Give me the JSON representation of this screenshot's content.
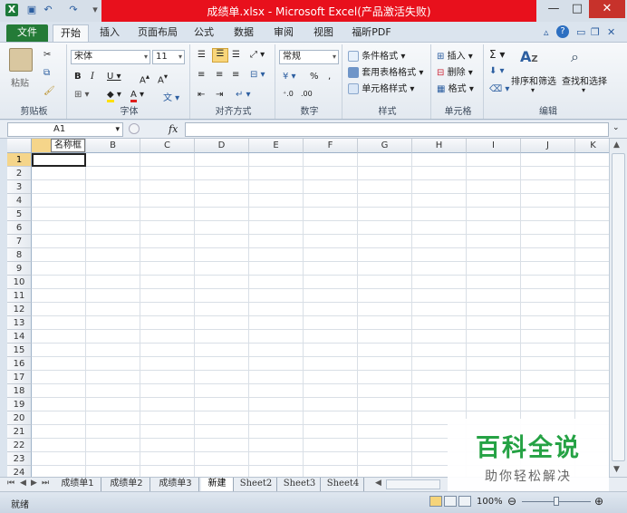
{
  "window": {
    "title": "成绩单.xlsx - Microsoft Excel(产品激活失败)",
    "title_bar_color": "#e8101c",
    "controls": [
      "—",
      "□",
      "✕"
    ]
  },
  "ribbon_tabs": [
    "文件",
    "开始",
    "插入",
    "页面布局",
    "公式",
    "数据",
    "审阅",
    "视图",
    "福昕PDF"
  ],
  "active_tab": "开始",
  "accent_color": "#247b37",
  "groups": {
    "clipboard": {
      "label": "剪贴板",
      "paste": "粘贴"
    },
    "font": {
      "label": "字体",
      "font_name": "宋体",
      "font_size": "11"
    },
    "alignment": {
      "label": "对齐方式"
    },
    "number": {
      "label": "数字",
      "format": "常规"
    },
    "styles": {
      "label": "样式",
      "items": [
        "条件格式",
        "套用表格格式",
        "单元格样式"
      ]
    },
    "cells": {
      "label": "单元格",
      "items": [
        "插入",
        "删除",
        "格式"
      ]
    },
    "editing": {
      "label": "编辑",
      "sort_filter": "排序和筛选",
      "find_select": "查找和选择"
    }
  },
  "formula_bar": {
    "name_box": "A1",
    "fx": "fx",
    "formula": ""
  },
  "name_box_tooltip": "名称框",
  "columns": [
    "A",
    "B",
    "C",
    "D",
    "E",
    "F",
    "G",
    "H",
    "I",
    "J",
    "K"
  ],
  "rows": [
    "1",
    "2",
    "3",
    "4",
    "5",
    "6",
    "7",
    "8",
    "9",
    "10",
    "11",
    "12",
    "13",
    "14",
    "15",
    "16",
    "17",
    "18",
    "19",
    "20",
    "21",
    "22",
    "23",
    "24"
  ],
  "selected_cell": "A1",
  "sheet_tabs": [
    "成绩单1",
    "成绩单2",
    "成绩单3",
    "新建",
    "Sheet2",
    "Sheet3",
    "Sheet4"
  ],
  "active_sheet": "新建",
  "status": {
    "text": "就绪",
    "zoom": "100%"
  },
  "watermark": {
    "main": "百科全说",
    "sub": "助你轻松解决"
  }
}
